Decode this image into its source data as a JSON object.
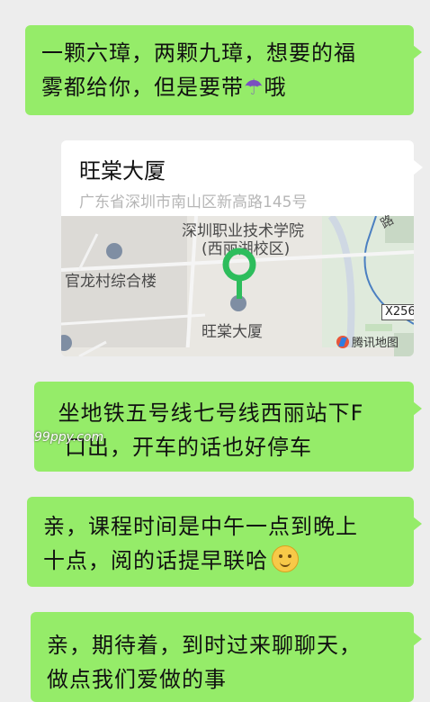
{
  "messages": [
    {
      "line1": "一颗六璋，两颗九璋，想要的福",
      "line2": "雾都给你，但是要带",
      "line2_tail": "哦",
      "emoji_icon": "umbrella-icon"
    },
    {
      "line1": " 坐地铁五号线七号线西丽站下F",
      "line2": "口出，开车的话也好停车"
    },
    {
      "line1": "亲，课程时间是中午一点到晚上",
      "line2": "十点，阅的话提早联哈",
      "emoji_icon": "smile-emoji-icon"
    },
    {
      "line1": "亲，期待着，到时过来聊聊天，",
      "line2": "做点我们爱做的事"
    }
  ],
  "location": {
    "title": "旺棠大厦",
    "address": "广东省深圳市南山区新高路145号",
    "map_labels": {
      "school_1": "深圳职业技术学院",
      "school_2": "(西丽湖校区)",
      "building": "官龙村综合楼",
      "target": "旺棠大厦",
      "road_tag": "X256",
      "road_side": "路",
      "provider": "腾讯地图"
    },
    "pin_color": "#2dbd5c"
  },
  "watermark": "99ppy.com",
  "colors": {
    "bubble": "#95ec69",
    "background": "#ededed"
  }
}
